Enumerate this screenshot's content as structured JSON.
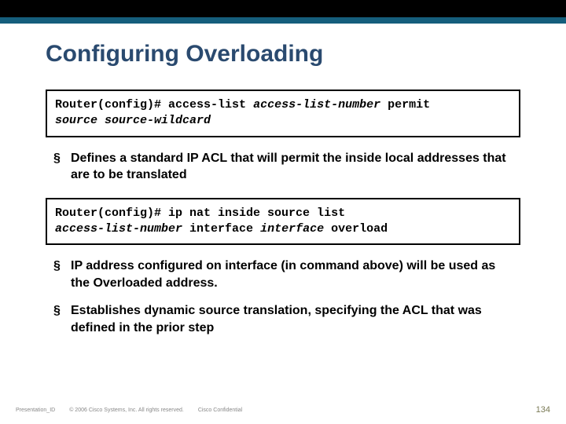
{
  "title": "Configuring Overloading",
  "cmd1": {
    "prompt": "Router(config)# ",
    "text": "access-list ",
    "param1": "access-list-number",
    "text2": " permit ",
    "param2": "source source-wildcard"
  },
  "bullets1": [
    "Defines a standard IP ACL that will permit the inside local addresses that are to be translated"
  ],
  "cmd2": {
    "prompt": "Router(config)# ",
    "text": "ip nat inside source list ",
    "param1": "access-list-number",
    "text2": " interface ",
    "param2": "interface",
    "text3": " overload"
  },
  "bullets2": [
    "IP address configured on interface (in command above) will be used as the Overloaded address.",
    "Establishes dynamic source translation, specifying the ACL that was defined in the prior step"
  ],
  "footer": {
    "id": "Presentation_ID",
    "copyright": "© 2006 Cisco Systems, Inc. All rights reserved.",
    "confidential": "Cisco Confidential",
    "page": "134"
  }
}
